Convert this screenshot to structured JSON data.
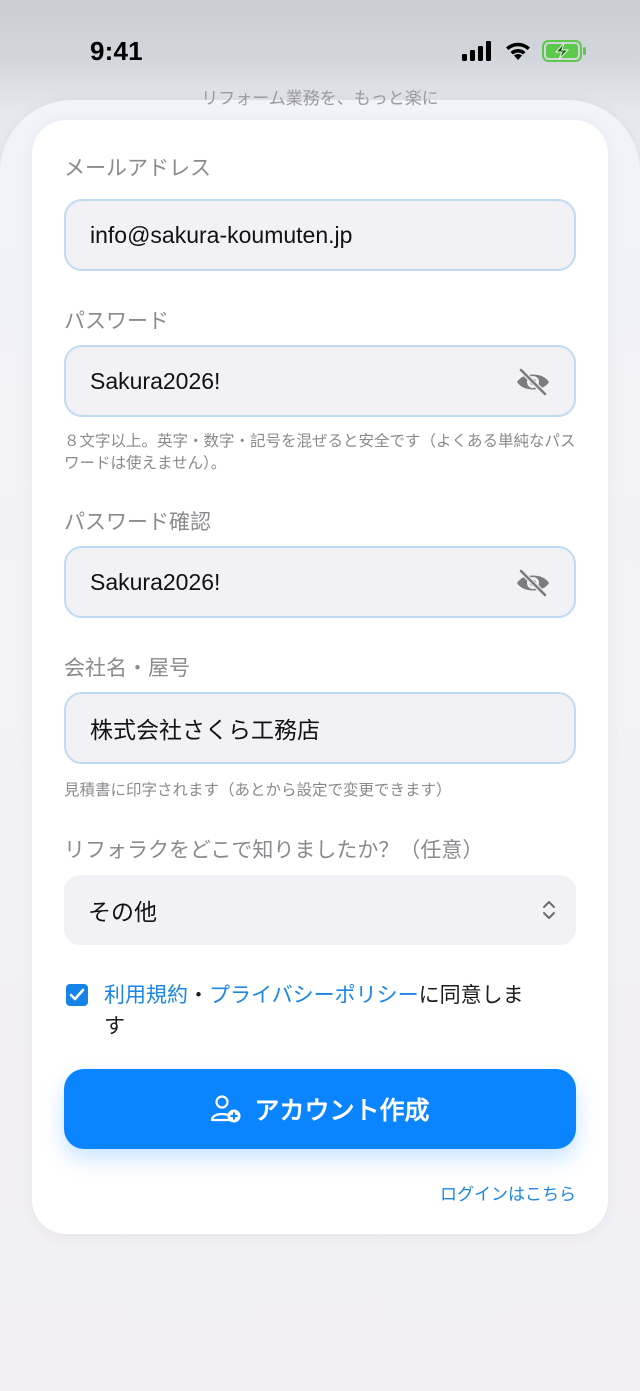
{
  "status_bar": {
    "time": "9:41"
  },
  "sheet": {
    "peek_text": "リフォーム業務を、もっと楽に"
  },
  "form": {
    "email": {
      "label": "メールアドレス",
      "value": "info@sakura-koumuten.jp"
    },
    "password": {
      "label": "パスワード",
      "value": "Sakura2026!",
      "hint": "８文字以上。英字・数字・記号を混ぜると安全です（よくある単純なパスワードは使えません）。"
    },
    "password_confirm": {
      "label": "パスワード確認",
      "value": "Sakura2026!"
    },
    "company": {
      "label": "会社名・屋号",
      "value": "株式会社さくら工務店",
      "hint": "見積書に印字されます（あとから設定で変更できます）"
    },
    "referral": {
      "label": "リフォラクをどこで知りましたか？（任意）",
      "selected": "その他"
    },
    "agreement": {
      "checked": true,
      "terms_link": "利用規約",
      "separator": "・",
      "privacy_link": "プライバシーポリシー",
      "suffix": "に同意します"
    },
    "submit_label": "アカウント作成",
    "login_link": "ログインはこちら"
  },
  "colors": {
    "accent": "#0a84ff",
    "link": "#1a86e8",
    "field_bg": "#f2f2f6",
    "field_border": "#bfdbf3"
  }
}
